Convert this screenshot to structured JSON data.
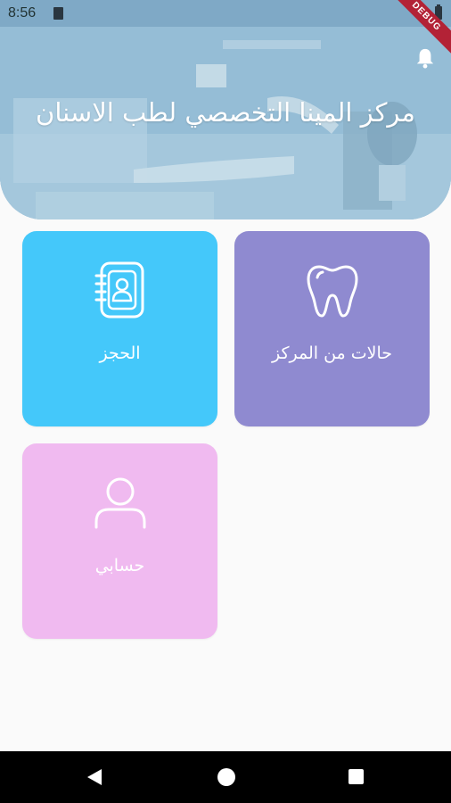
{
  "status_bar": {
    "time": "8:56",
    "icons": [
      "sim-card-icon",
      "wifi-icon",
      "battery-icon"
    ]
  },
  "debug_banner": {
    "label": "DEBUG"
  },
  "header": {
    "title": "مركز المينا التخصصي لطب الاسنان",
    "notification_icon": "bell-icon"
  },
  "tiles": [
    {
      "label": "الحجز",
      "icon": "contact-book-icon",
      "color": "#44c8fa"
    },
    {
      "label": "حالات من المركز",
      "icon": "tooth-icon",
      "color": "#8f8ad0"
    },
    {
      "label": "حسابي",
      "icon": "user-icon",
      "color": "#f0baf0"
    }
  ],
  "nav_bar": {
    "buttons": [
      "back-button",
      "home-button",
      "recents-button"
    ]
  }
}
